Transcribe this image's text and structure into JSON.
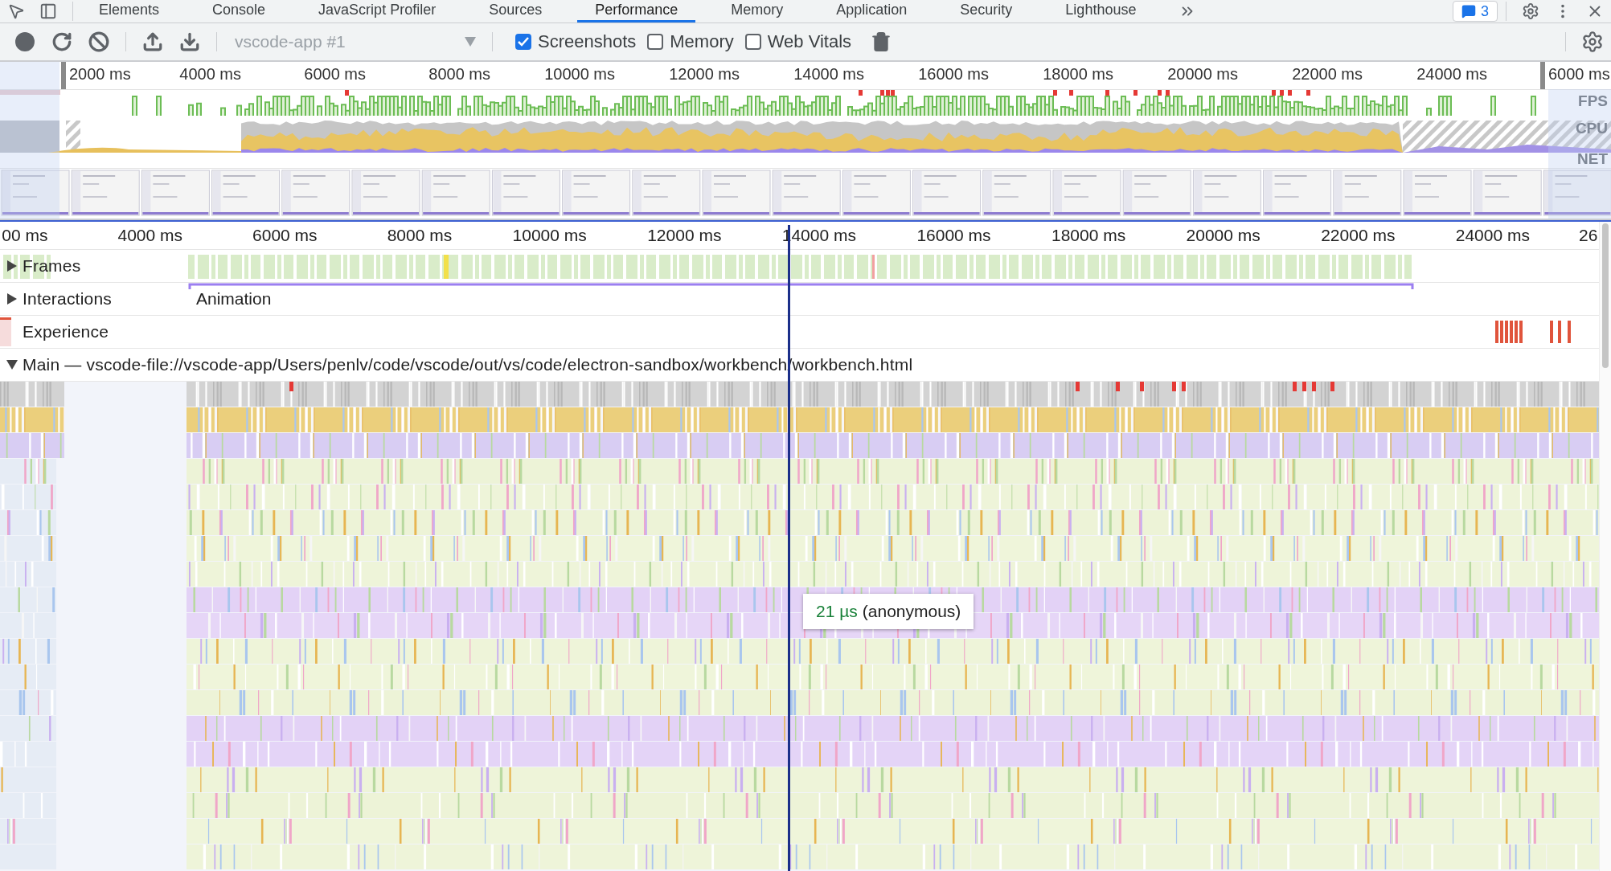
{
  "devtools_tabs": [
    {
      "label": "Elements",
      "selected": false
    },
    {
      "label": "Console",
      "selected": false
    },
    {
      "label": "JavaScript Profiler",
      "selected": false
    },
    {
      "label": "Sources",
      "selected": false
    },
    {
      "label": "Performance",
      "selected": true
    },
    {
      "label": "Memory",
      "selected": false
    },
    {
      "label": "Application",
      "selected": false
    },
    {
      "label": "Security",
      "selected": false
    },
    {
      "label": "Lighthouse",
      "selected": false
    }
  ],
  "issues_badge": {
    "count": "3"
  },
  "toolbar": {
    "target": "vscode-app #1",
    "checkboxes": [
      {
        "label": "Screenshots",
        "checked": true
      },
      {
        "label": "Memory",
        "checked": false
      },
      {
        "label": "Web Vitals",
        "checked": false
      }
    ]
  },
  "overview": {
    "ruler": [
      "2000 ms",
      "4000 ms",
      "6000 ms",
      "8000 ms",
      "10000 ms",
      "12000 ms",
      "14000 ms",
      "16000 ms",
      "18000 ms",
      "20000 ms",
      "22000 ms",
      "24000 ms",
      "6000 ms"
    ],
    "tracks": [
      "FPS",
      "CPU",
      "NET"
    ]
  },
  "timeline": {
    "ruler": [
      "00 ms",
      "4000 ms",
      "6000 ms",
      "8000 ms",
      "10000 ms",
      "12000 ms",
      "14000 ms",
      "16000 ms",
      "18000 ms",
      "20000 ms",
      "22000 ms",
      "24000 ms",
      "26"
    ],
    "tracks": [
      {
        "kind": "frames",
        "label": "Frames",
        "expanded": false
      },
      {
        "kind": "interactions",
        "label": "Interactions",
        "expanded": false,
        "event": "Animation"
      },
      {
        "kind": "experience",
        "label": "Experience"
      },
      {
        "kind": "thread",
        "label": "Main — vscode-file://vscode-app/Users/penlv/code/vscode/out/vs/code/electron-sandbox/workbench/workbench.html",
        "expanded": true
      }
    ]
  },
  "tooltip": {
    "duration": "21 µs",
    "name": "(anonymous)"
  }
}
